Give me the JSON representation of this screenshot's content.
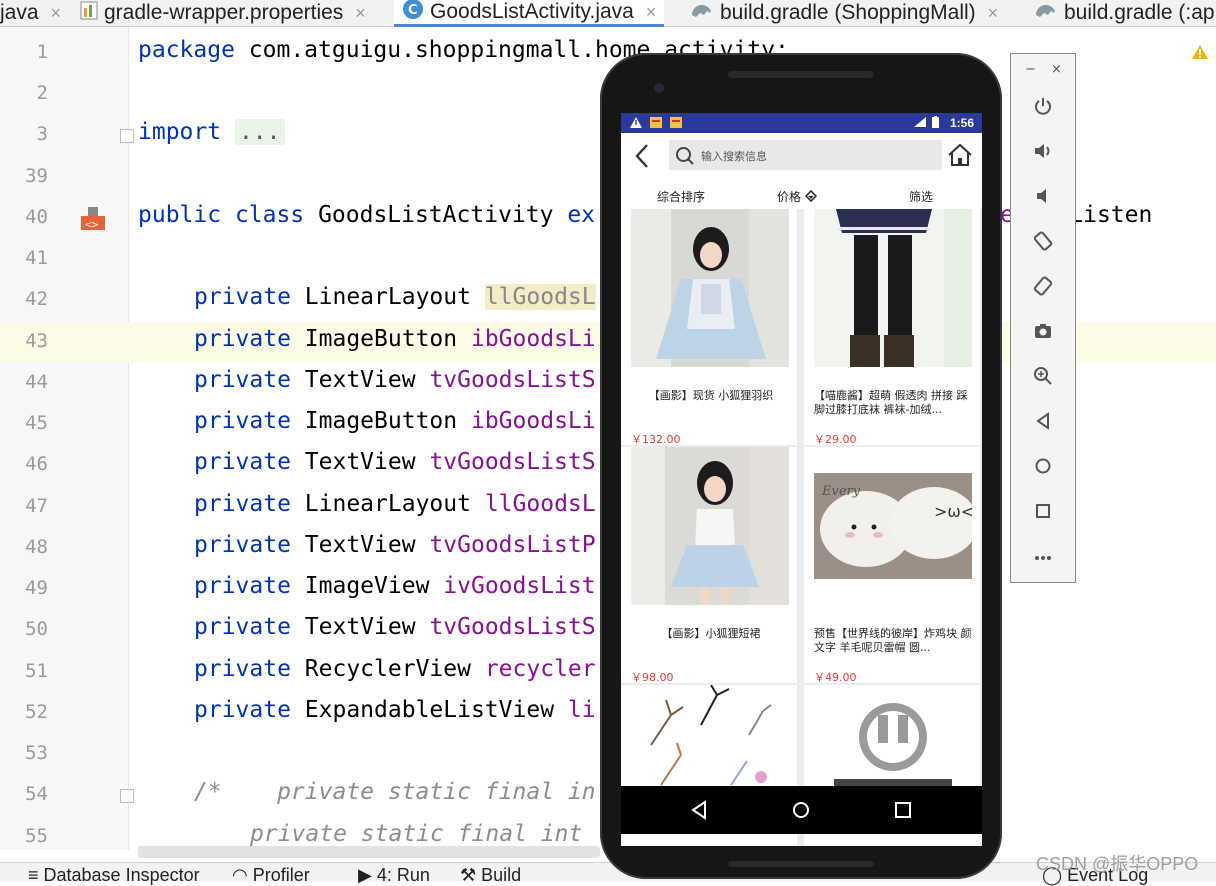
{
  "tabs": [
    {
      "label": "java",
      "active": false
    },
    {
      "label": "gradle-wrapper.properties",
      "active": false
    },
    {
      "label": "GoodsListActivity.java",
      "active": true
    },
    {
      "label": "build.gradle (ShoppingMall)",
      "active": false
    },
    {
      "label": "build.gradle (:ap",
      "active": false
    }
  ],
  "code_lines": [
    {
      "num": "1",
      "text": "package com.atguigu.shoppingmall.home.activity;"
    },
    {
      "num": "2",
      "text": ""
    },
    {
      "num": "3",
      "text": "import ..."
    },
    {
      "num": "39",
      "text": ""
    },
    {
      "num": "40",
      "text": "public class GoodsListActivity ex"
    },
    {
      "num": "41",
      "text": ""
    },
    {
      "num": "42",
      "text": "private LinearLayout llGoodsL"
    },
    {
      "num": "43",
      "text": "private ImageButton ibGoodsLi"
    },
    {
      "num": "44",
      "text": "private TextView tvGoodsListS"
    },
    {
      "num": "45",
      "text": "private ImageButton ibGoodsLi"
    },
    {
      "num": "46",
      "text": "private TextView tvGoodsListS"
    },
    {
      "num": "47",
      "text": "private LinearLayout llGoodsL"
    },
    {
      "num": "48",
      "text": "private TextView tvGoodsListP"
    },
    {
      "num": "49",
      "text": "private ImageView ivGoodsList"
    },
    {
      "num": "50",
      "text": "private TextView tvGoodsListS"
    },
    {
      "num": "51",
      "text": "private RecyclerView recycler"
    },
    {
      "num": "52",
      "text": "private ExpandableListView li"
    },
    {
      "num": "53",
      "text": ""
    },
    {
      "num": "54",
      "text": "/*    private static final in"
    },
    {
      "num": "55",
      "text": "private static final int"
    }
  ],
  "code": {
    "l1_kw": "package",
    "l1_rest": "com.atguigu.shoppingmall.home.activity;",
    "l3_kw": "import",
    "l3_fold": "...",
    "l40_kw1": "public",
    "l40_kw2": "class",
    "l40_name": "GoodsListActivity",
    "l40_kw3": "ex",
    "l40_tail": "lickListen",
    "tail_fragment": "e",
    "private_kw": "private",
    "fields": [
      {
        "type": "LinearLayout",
        "name": "llGoodsL",
        "overridden": true
      },
      {
        "type": "ImageButton",
        "name": "ibGoodsLi"
      },
      {
        "type": "TextView",
        "name": "tvGoodsListS"
      },
      {
        "type": "ImageButton",
        "name": "ibGoodsLi"
      },
      {
        "type": "TextView",
        "name": "tvGoodsListS"
      },
      {
        "type": "LinearLayout",
        "name": "llGoodsL"
      },
      {
        "type": "TextView",
        "name": "tvGoodsListP"
      },
      {
        "type": "ImageView",
        "name": "ivGoodsList"
      },
      {
        "type": "TextView",
        "name": "tvGoodsListS"
      },
      {
        "type": "RecyclerView",
        "name": "recycler"
      },
      {
        "type": "ExpandableListView",
        "name": "li"
      }
    ],
    "l54": "/*    private static final in",
    "l55": "private static final int"
  },
  "bottom_bar": {
    "db_inspector": "Database Inspector",
    "profiler": "Profiler",
    "run": "4: Run",
    "build": "Build",
    "event_log": "Event Log"
  },
  "watermark": "CSDN @振华OPPO",
  "emulator_tools": {
    "minimize": "−",
    "close": "×",
    "items": [
      "power-icon",
      "volume-up-icon",
      "volume-down-icon",
      "rotate-left-icon",
      "rotate-right-icon",
      "camera-icon",
      "zoom-icon",
      "back-icon",
      "home-icon",
      "overview-icon",
      "more-icon"
    ]
  },
  "phone": {
    "status_time": "1:56",
    "search_placeholder": "输入搜索信息",
    "sort": {
      "composite": "综合排序",
      "price": "价格",
      "filter": "筛选"
    },
    "goods": [
      {
        "name": "【画影】现货 小狐狸羽织",
        "price": "￥132.00",
        "centered": true
      },
      {
        "name": "【喵鹿酱】超萌 假透肉 拼接 踩脚过膝打底袜 裤袜-加绒...",
        "price": "￥29.00",
        "centered": false
      },
      {
        "name": "【画影】小狐狸短裙",
        "price": "￥98.00",
        "centered": true
      },
      {
        "name": "预售【世界线的彼岸】炸鸡块 颜文字 羊毛呢贝雷帽 圆...",
        "price": "￥49.00",
        "centered": false
      }
    ],
    "thumb_text_every": "Every"
  },
  "colors": {
    "keyword": "#0033b3",
    "field": "#871094",
    "status_bar": "#2b3a9a",
    "price": "#e53935"
  }
}
